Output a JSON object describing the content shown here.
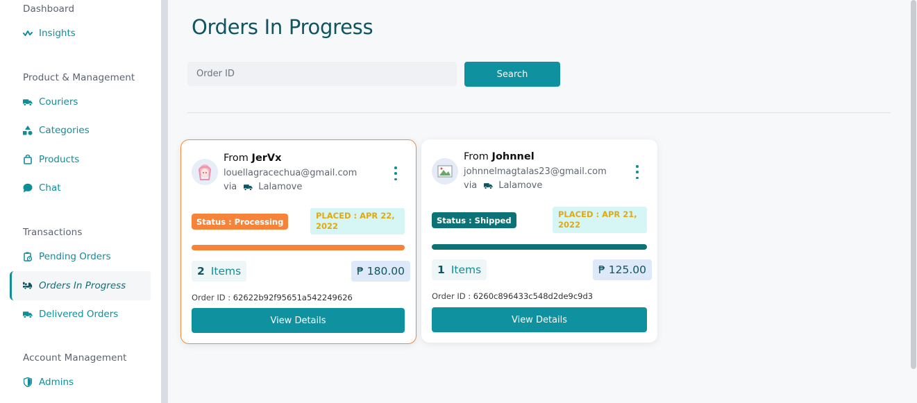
{
  "sidebar": {
    "sections": [
      {
        "title": "Dashboard",
        "items": [
          {
            "label": "Insights",
            "icon": "insights-icon"
          }
        ]
      },
      {
        "title": "Product & Management",
        "items": [
          {
            "label": "Couriers",
            "icon": "truck-icon"
          },
          {
            "label": "Categories",
            "icon": "shapes-icon"
          },
          {
            "label": "Products",
            "icon": "bag-icon"
          },
          {
            "label": "Chat",
            "icon": "chat-bubble-icon"
          }
        ]
      },
      {
        "title": "Transactions",
        "items": [
          {
            "label": "Pending Orders",
            "icon": "clipboard-clock-icon"
          },
          {
            "label": "Orders In Progress",
            "icon": "truck-loading-icon",
            "active": true
          },
          {
            "label": "Delivered Orders",
            "icon": "truck-icon"
          }
        ]
      },
      {
        "title": "Account Management",
        "items": [
          {
            "label": "Admins",
            "icon": "shield-icon"
          }
        ]
      }
    ]
  },
  "main": {
    "title": "Orders In Progress",
    "search": {
      "placeholder": "Order ID",
      "value": "",
      "button_label": "Search"
    }
  },
  "orders": [
    {
      "from_prefix": "From",
      "from_name": "JerVx",
      "email": "louellagracechua@gmail.com",
      "via_prefix": "via",
      "courier": "Lalamove",
      "status": "Status : Processing",
      "status_color": "#f5843a",
      "placed": "PLACED : APR 22, 2022",
      "progress_color": "#f5843a",
      "items_count": "2",
      "items_label": "Items",
      "price": "₱ 180.00",
      "order_id_label": "Order ID :",
      "order_id": "62622b92f95651a542249626",
      "button_label": "View Details",
      "highlighted": true
    },
    {
      "from_prefix": "From",
      "from_name": "Johnnel",
      "email": "johnnelmagtalas23@gmail.com",
      "via_prefix": "via",
      "courier": "Lalamove",
      "status": "Status : Shipped",
      "status_color": "#0d7276",
      "placed": "PLACED : APR 21, 2022",
      "progress_color": "#0d7276",
      "items_count": "1",
      "items_label": "Items",
      "price": "₱ 125.00",
      "order_id_label": "Order ID :",
      "order_id": "6260c896433c548d2de9c9d3",
      "button_label": "View Details",
      "highlighted": false
    }
  ],
  "colors": {
    "accent": "#0f919f",
    "title": "#0d5560",
    "processing": "#f5843a",
    "shipped": "#0d7276",
    "placed": "#e0a914"
  }
}
